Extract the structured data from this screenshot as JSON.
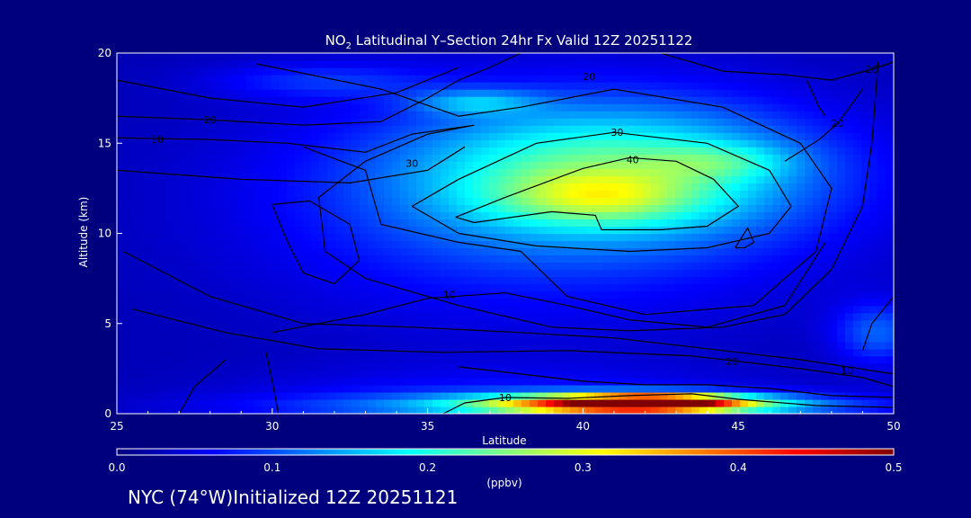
{
  "chart_data": {
    "type": "heatmap",
    "title_prefix": "NO",
    "title_subscript": "2",
    "title_rest": " Latitudinal Y–Section 24hr  Fx Valid 12Z 20251122",
    "xlabel": "Latitude",
    "ylabel": "Altitude (km)",
    "xlim": [
      25,
      50
    ],
    "ylim": [
      0,
      20
    ],
    "x_ticks": [
      25,
      30,
      35,
      40,
      45,
      50
    ],
    "y_ticks": [
      0,
      5,
      10,
      15,
      20
    ],
    "colorbar": {
      "label": "(ppbv)",
      "range": [
        0.0,
        0.5
      ],
      "ticks": [
        "0.0",
        "0.1",
        "0.2",
        "0.3",
        "0.4",
        "0.5"
      ],
      "colormap": [
        "#00007f",
        "#0000ff",
        "#0080ff",
        "#00ffff",
        "#80ff80",
        "#ffff00",
        "#ff8000",
        "#ff0000",
        "#7f0000"
      ]
    },
    "field_blobs": [
      {
        "lat": 41.0,
        "alt": 13.5,
        "sx": 4.5,
        "sy": 2.6,
        "v": 0.16
      },
      {
        "lat": 40.5,
        "alt": 12.0,
        "sx": 2.2,
        "sy": 1.0,
        "v": 0.09
      },
      {
        "lat": 44.5,
        "alt": 14.0,
        "sx": 1.6,
        "sy": 0.7,
        "v": 0.06
      },
      {
        "lat": 36.5,
        "alt": 17.3,
        "sx": 1.4,
        "sy": 0.5,
        "v": 0.08
      },
      {
        "lat": 38.5,
        "alt": 11.5,
        "sx": 6.5,
        "sy": 4.5,
        "v": 0.07
      },
      {
        "lat": 31.5,
        "alt": 18.5,
        "sx": 2.5,
        "sy": 0.7,
        "v": 0.05
      },
      {
        "lat": 49.5,
        "alt": 4.5,
        "sx": 1.0,
        "sy": 1.2,
        "v": 0.08
      },
      {
        "lat": 41.5,
        "alt": 0.55,
        "sx": 3.0,
        "sy": 0.38,
        "v": 0.38
      },
      {
        "lat": 42.5,
        "alt": 0.7,
        "sx": 1.6,
        "sy": 0.25,
        "v": 0.2
      },
      {
        "lat": 40.0,
        "alt": 0.4,
        "sx": 6.5,
        "sy": 0.55,
        "v": 0.1
      },
      {
        "lat": 37.5,
        "alt": 0.9,
        "sx": 6.0,
        "sy": 1.2,
        "v": 0.04
      }
    ],
    "field_base": 0.025,
    "contours": [
      {
        "label": "40",
        "label_at": [
          41.6,
          14.1
        ],
        "pts": [
          [
            35.9,
            10.9
          ],
          [
            37.5,
            12.0
          ],
          [
            40.0,
            13.6
          ],
          [
            41.5,
            14.2
          ],
          [
            43.0,
            14.0
          ],
          [
            44.2,
            13.0
          ],
          [
            45.0,
            11.5
          ],
          [
            44.0,
            10.4
          ],
          [
            42.5,
            10.2
          ],
          [
            40.6,
            10.2
          ],
          [
            40.4,
            11.0
          ],
          [
            39.0,
            11.2
          ],
          [
            36.5,
            10.6
          ],
          [
            35.9,
            10.9
          ]
        ]
      },
      {
        "label": "30",
        "label_at": [
          41.1,
          15.6
        ],
        "pts": [
          [
            34.5,
            11.5
          ],
          [
            36.0,
            13.0
          ],
          [
            38.5,
            15.0
          ],
          [
            41.0,
            15.6
          ],
          [
            44.0,
            15.0
          ],
          [
            46.0,
            13.5
          ],
          [
            46.7,
            11.5
          ],
          [
            46.0,
            10.0
          ],
          [
            44.0,
            9.2
          ],
          [
            41.5,
            9.0
          ],
          [
            38.5,
            9.3
          ],
          [
            36.0,
            10.0
          ],
          [
            34.5,
            11.5
          ]
        ]
      },
      {
        "label": "20",
        "label_at": [
          40.2,
          18.7
        ],
        "pts": [
          [
            29.5,
            19.4
          ],
          [
            33.5,
            18.0
          ],
          [
            36.0,
            16.5
          ],
          [
            38.0,
            17.0
          ],
          [
            41.0,
            18.0
          ],
          [
            44.5,
            17.0
          ],
          [
            47.0,
            15.0
          ],
          [
            48.0,
            12.5
          ],
          [
            47.5,
            9.0
          ],
          [
            45.5,
            6.0
          ],
          [
            42.0,
            5.5
          ],
          [
            39.5,
            6.5
          ],
          [
            38.0,
            9.0
          ],
          [
            36.0,
            9.5
          ],
          [
            33.5,
            10.5
          ],
          [
            33.0,
            13.5
          ],
          [
            31.0,
            14.8
          ]
        ]
      },
      {
        "label": "10",
        "label_at": [
          26.3,
          15.2
        ],
        "pts": [
          [
            25.0,
            15.3
          ],
          [
            28.0,
            15.2
          ],
          [
            30.5,
            15.0
          ],
          [
            33.0,
            14.5
          ],
          [
            34.5,
            15.5
          ],
          [
            36.5,
            16.0
          ],
          [
            35.0,
            15.5
          ],
          [
            33.0,
            14.0
          ],
          [
            31.5,
            12.0
          ],
          [
            31.7,
            9.0
          ],
          [
            33.0,
            7.5
          ],
          [
            36.0,
            6.0
          ],
          [
            39.0,
            4.8
          ],
          [
            41.5,
            4.6
          ],
          [
            44.5,
            4.8
          ],
          [
            46.5,
            5.5
          ],
          [
            48.0,
            8.0
          ],
          [
            49.0,
            11.5
          ],
          [
            49.3,
            15.0
          ],
          [
            49.5,
            19.5
          ]
        ]
      },
      {
        "label": "10",
        "label_at": [
          35.7,
          6.6
        ],
        "pts": [
          [
            30.0,
            4.5
          ],
          [
            33.0,
            5.5
          ],
          [
            35.0,
            6.4
          ],
          [
            37.5,
            6.7
          ],
          [
            39.5,
            6.0
          ],
          [
            41.5,
            5.2
          ],
          [
            44.0,
            4.8
          ],
          [
            46.5,
            6.0
          ],
          [
            47.8,
            9.5
          ]
        ]
      },
      {
        "label": "10",
        "label_at": [
          48.5,
          2.4
        ],
        "pts": [
          [
            25.5,
            5.8
          ],
          [
            28.5,
            4.5
          ],
          [
            31.5,
            3.6
          ],
          [
            35.5,
            3.4
          ],
          [
            39.5,
            3.5
          ],
          [
            43.5,
            3.2
          ],
          [
            47.0,
            2.5
          ],
          [
            49.0,
            2.0
          ],
          [
            50.0,
            1.5
          ]
        ]
      },
      {
        "label": "10",
        "label_at": [
          37.5,
          0.9
        ],
        "pts": [
          [
            35.5,
            0.0
          ],
          [
            36.2,
            0.6
          ],
          [
            37.5,
            0.9
          ],
          [
            39.5,
            0.85
          ],
          [
            41.5,
            1.0
          ],
          [
            43.5,
            1.1
          ],
          [
            45.0,
            0.8
          ],
          [
            47.5,
            0.45
          ],
          [
            50.0,
            0.35
          ]
        ]
      },
      {
        "label": "20",
        "label_at": [
          44.8,
          2.9
        ],
        "pts": [
          [
            25.2,
            9.0
          ],
          [
            28.0,
            6.5
          ],
          [
            31.0,
            5.0
          ],
          [
            34.5,
            4.8
          ],
          [
            38.0,
            4.5
          ],
          [
            41.0,
            4.2
          ],
          [
            44.0,
            3.6
          ],
          [
            47.0,
            3.0
          ],
          [
            50.0,
            2.2
          ]
        ]
      },
      {
        "label": "20",
        "label_at": [
          28.0,
          16.3
        ],
        "pts": [
          [
            25.0,
            16.5
          ],
          [
            28.0,
            16.3
          ],
          [
            31.0,
            16.0
          ],
          [
            33.5,
            16.2
          ],
          [
            35.0,
            17.5
          ],
          [
            36.0,
            18.5
          ],
          [
            37.0,
            19.2
          ],
          [
            38.0,
            20.0
          ]
        ]
      },
      {
        "label": "30",
        "label_at": [
          34.5,
          13.9
        ],
        "pts": [
          [
            25.0,
            13.5
          ],
          [
            29.0,
            13.0
          ],
          [
            32.5,
            12.8
          ],
          [
            35.0,
            13.5
          ],
          [
            36.2,
            14.8
          ]
        ]
      },
      {
        "label": "20",
        "label_at": [
          49.3,
          19.1
        ],
        "pts": [
          [
            42.5,
            20.0
          ],
          [
            44.5,
            19.0
          ],
          [
            46.5,
            18.8
          ],
          [
            48.0,
            18.5
          ],
          [
            49.3,
            19.1
          ],
          [
            50.0,
            19.5
          ]
        ]
      },
      {
        "label": "20",
        "label_at": [
          48.2,
          16.1
        ],
        "pts": [
          [
            46.5,
            14.0
          ],
          [
            47.6,
            15.2
          ],
          [
            48.2,
            16.1
          ],
          [
            49.0,
            18.0
          ]
        ]
      },
      {
        "label": "",
        "label_at": null,
        "pts": [
          [
            30.0,
            11.6
          ],
          [
            31.2,
            11.8
          ],
          [
            32.5,
            10.5
          ],
          [
            32.8,
            8.5
          ],
          [
            32.0,
            7.2
          ],
          [
            31.0,
            7.8
          ],
          [
            30.5,
            9.5
          ],
          [
            30.0,
            11.6
          ]
        ]
      },
      {
        "label": "",
        "label_at": null,
        "pts": [
          [
            44.9,
            9.2
          ],
          [
            45.3,
            10.3
          ],
          [
            45.5,
            9.5
          ],
          [
            45.2,
            9.2
          ],
          [
            44.9,
            9.2
          ]
        ]
      },
      {
        "label": "",
        "label_at": null,
        "pts": [
          [
            36.0,
            2.6
          ],
          [
            38.0,
            2.2
          ],
          [
            40.0,
            1.8
          ],
          [
            42.0,
            1.6
          ],
          [
            44.0,
            1.6
          ],
          [
            46.0,
            1.4
          ],
          [
            48.0,
            1.0
          ],
          [
            50.0,
            0.9
          ]
        ]
      },
      {
        "label": "",
        "label_at": null,
        "pts": [
          [
            47.2,
            18.5
          ],
          [
            47.6,
            17.0
          ],
          [
            47.8,
            16.5
          ]
        ]
      },
      {
        "label": "",
        "label_at": null,
        "pts": [
          [
            49.0,
            3.5
          ],
          [
            49.3,
            5.0
          ],
          [
            50.0,
            6.5
          ]
        ]
      },
      {
        "label": "",
        "label_at": null,
        "pts": [
          [
            25.0,
            18.5
          ],
          [
            28.0,
            17.5
          ],
          [
            31.0,
            17.0
          ],
          [
            34.0,
            17.8
          ],
          [
            36.0,
            19.2
          ]
        ]
      },
      {
        "label": "",
        "label_at": null,
        "pts": [
          [
            27.0,
            0.0
          ],
          [
            27.5,
            1.5
          ],
          [
            28.5,
            3.0
          ]
        ]
      },
      {
        "label": "",
        "label_at": null,
        "pts": [
          [
            30.2,
            0.0
          ],
          [
            30.0,
            1.8
          ],
          [
            29.8,
            3.4
          ]
        ]
      }
    ]
  },
  "footer": {
    "location": "NYC (74°W)Initialized 12Z 20251121"
  }
}
